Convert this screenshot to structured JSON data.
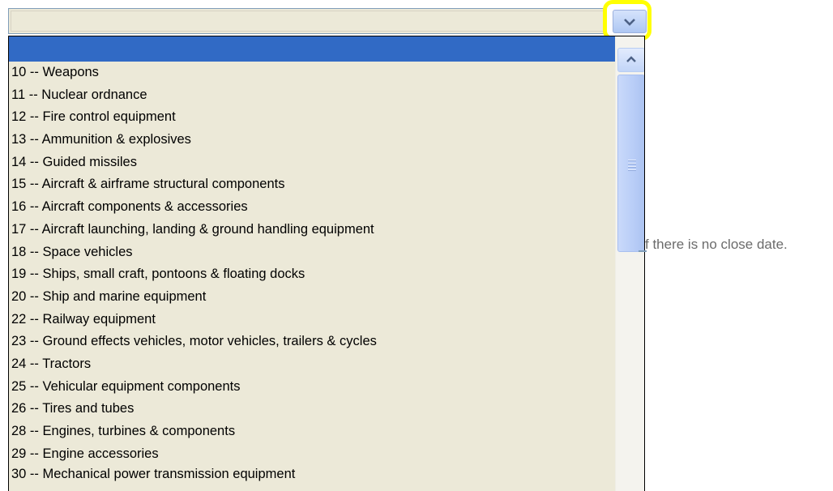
{
  "select": {
    "value": ""
  },
  "hint_text": "f there is no close date.",
  "colors": {
    "highlight": "#ffff00",
    "selection": "#316ac5",
    "list_bg": "#ece9d8"
  },
  "icons": {
    "dropdown": "chevron-down-icon",
    "scroll_up": "chevron-up-icon",
    "thumb": "grip-icon"
  },
  "options": [
    "",
    "10 -- Weapons",
    "11 -- Nuclear ordnance",
    "12 -- Fire control equipment",
    "13 -- Ammunition & explosives",
    "14 -- Guided missiles",
    "15 -- Aircraft & airframe structural components",
    "16 -- Aircraft components & accessories",
    "17 -- Aircraft launching, landing & ground handling equipment",
    "18 -- Space vehicles",
    "19 -- Ships, small craft, pontoons & floating docks",
    "20 -- Ship and marine equipment",
    "22 -- Railway equipment",
    "23 -- Ground effects vehicles, motor vehicles, trailers & cycles",
    "24 -- Tractors",
    "25 -- Vehicular equipment components",
    "26 -- Tires and tubes",
    "28 -- Engines, turbines & components",
    "29 -- Engine accessories",
    "30 -- Mechanical power transmission equipment"
  ]
}
